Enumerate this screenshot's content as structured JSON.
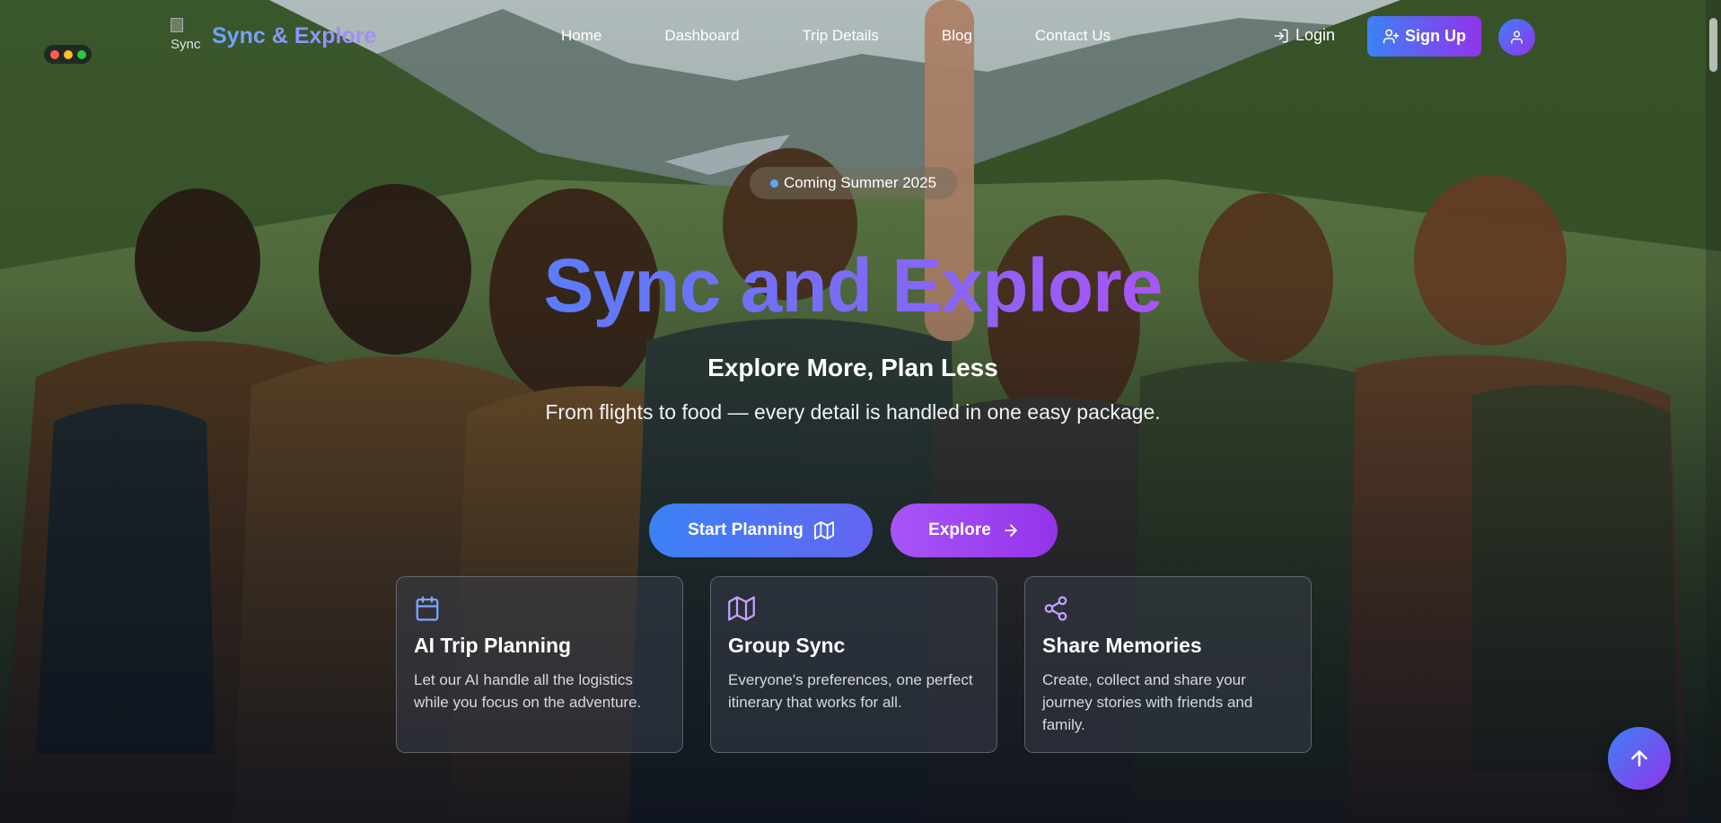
{
  "colors": {
    "brand_blue": "#3b82f6",
    "brand_purple": "#9333ea",
    "accent_gradient": [
      "#5b7cfa",
      "#a855f7"
    ],
    "window_dots": [
      "#ff5f57",
      "#febc2e",
      "#28c840"
    ]
  },
  "nav": {
    "logo_alt": "Sync",
    "brand": "Sync & Explore",
    "links": [
      {
        "label": "Home"
      },
      {
        "label": "Dashboard"
      },
      {
        "label": "Trip Details"
      },
      {
        "label": "Blog"
      },
      {
        "label": "Contact Us"
      }
    ],
    "login_label": "Login",
    "login_icon": "log-in-icon",
    "signup_label": "Sign Up",
    "signup_icon": "user-plus-icon",
    "avatar_icon": "user-icon"
  },
  "hero": {
    "badge": "Coming Summer 2025",
    "title": "Sync and Explore",
    "subtitle": "Explore More, Plan Less",
    "description": "From flights to food — every detail is handled in one easy package.",
    "primary_button": {
      "label": "Start Planning",
      "icon": "map-icon"
    },
    "secondary_button": {
      "label": "Explore",
      "icon": "arrow-right-icon"
    }
  },
  "features": [
    {
      "icon": "calendar-icon",
      "title": "AI Trip Planning",
      "description": "Let our AI handle all the logistics while you focus on the adventure."
    },
    {
      "icon": "map-icon",
      "title": "Group Sync",
      "description": "Everyone's preferences, one perfect itinerary that works for all."
    },
    {
      "icon": "share-icon",
      "title": "Share Memories",
      "description": "Create, collect and share your journey stories with friends and family."
    }
  ],
  "scroll_top_icon": "arrow-up-icon"
}
